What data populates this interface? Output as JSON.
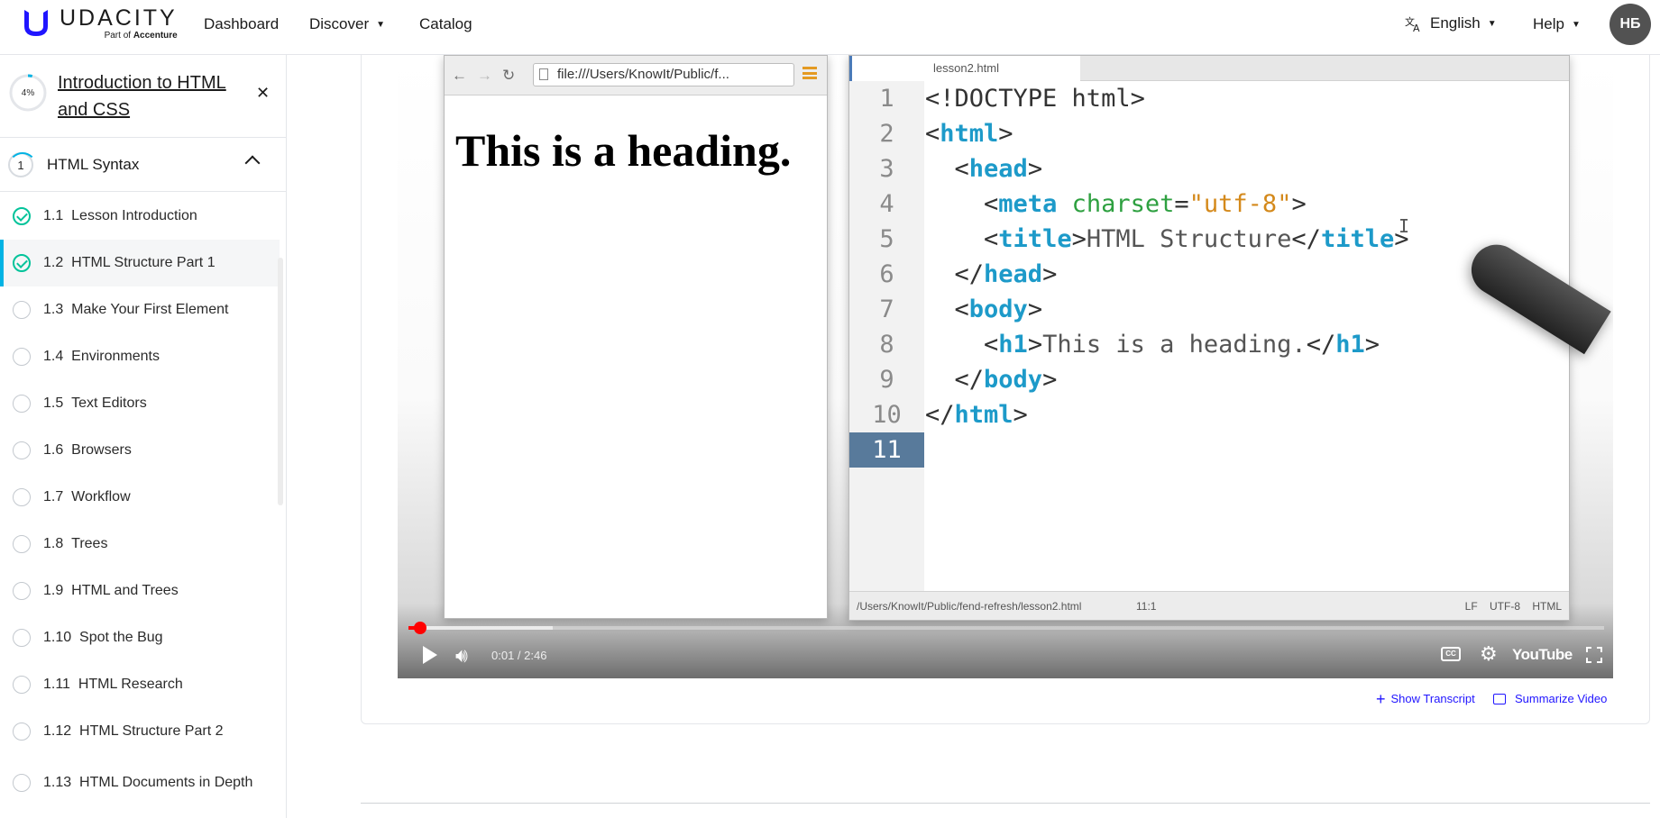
{
  "header": {
    "logo_word": "UDACITY",
    "logo_sub_prefix": "Part of",
    "logo_sub_brand": "Accenture",
    "nav": [
      "Dashboard",
      "Discover",
      "Catalog"
    ],
    "language": "English",
    "help": "Help",
    "avatar_initials": "НБ",
    "brand_color": "#2015ff"
  },
  "sidebar": {
    "progress": "4%",
    "progress_value": 0.04,
    "course_title": "Introduction to HTML and CSS",
    "lesson_number": "1",
    "lesson_title": "HTML Syntax",
    "concepts": [
      {
        "num": "1.1",
        "label": "Lesson Introduction",
        "status": "done"
      },
      {
        "num": "1.2",
        "label": "HTML Structure Part 1",
        "status": "done"
      },
      {
        "num": "1.3",
        "label": "Make Your First Element",
        "status": "todo"
      },
      {
        "num": "1.4",
        "label": "Environments",
        "status": "todo"
      },
      {
        "num": "1.5",
        "label": "Text Editors",
        "status": "todo"
      },
      {
        "num": "1.6",
        "label": "Browsers",
        "status": "todo"
      },
      {
        "num": "1.7",
        "label": "Workflow",
        "status": "todo"
      },
      {
        "num": "1.8",
        "label": "Trees",
        "status": "todo"
      },
      {
        "num": "1.9",
        "label": "HTML and Trees",
        "status": "todo"
      },
      {
        "num": "1.10",
        "label": "Spot the Bug",
        "status": "todo"
      },
      {
        "num": "1.11",
        "label": "HTML Research",
        "status": "todo"
      },
      {
        "num": "1.12",
        "label": "HTML Structure Part 2",
        "status": "todo"
      },
      {
        "num": "1.13",
        "label": "HTML Documents in Depth",
        "status": "todo"
      }
    ],
    "active_index": 1
  },
  "video": {
    "browser_url": "file:///Users/KnowIt/Public/f...",
    "rendered_heading": "This is a heading.",
    "editor_tab": "lesson2.html",
    "code_lines": [
      "1",
      "2",
      "3",
      "4",
      "5",
      "6",
      "7",
      "8",
      "9",
      "10",
      "11"
    ],
    "status_path": "/Users/KnowIt/Public/fend-refresh/lesson2.html",
    "status_pos": "11:1",
    "status_right": "LF    UTF-8    HTML",
    "time": "0:01 / 2:46",
    "cc_label": "CC",
    "youtube_label": "YouTube",
    "progress_value": 0.006
  },
  "actions": {
    "show_transcript": "Show Transcript",
    "summarize_video": "Summarize Video"
  }
}
